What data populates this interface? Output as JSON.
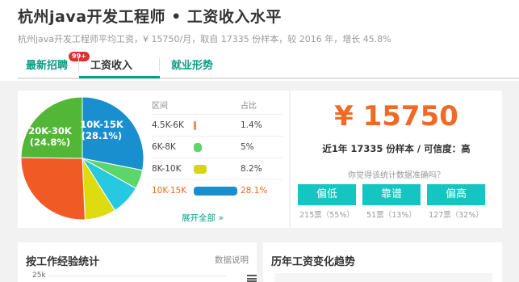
{
  "page": {
    "title": "杭州java开发工程师 • 工资收入水平",
    "subtitle": "杭州java开发工程师平均工资，¥ 15750/月，取自 17335 份样本，较 2016 年，增长 45.8%"
  },
  "tabs": [
    {
      "label": "最新招聘",
      "badge": "99+"
    },
    {
      "label": "工资收入",
      "active": true
    },
    {
      "label": "就业形势"
    }
  ],
  "distribution": {
    "col_range": "区间",
    "col_ratio": "占比",
    "rows": [
      {
        "range": "4.5K-6K",
        "percent": "1.4%",
        "value": 1.4,
        "color": "#ef8a5a"
      },
      {
        "range": "6K-8K",
        "percent": "5%",
        "value": 5,
        "color": "#5ad66a"
      },
      {
        "range": "8K-10K",
        "percent": "8.2%",
        "value": 8.2,
        "color": "#d9d40f"
      },
      {
        "range": "10K-15K",
        "percent": "28.1%",
        "value": 28.1,
        "color": "#1a8fcf",
        "highlight": true
      }
    ],
    "expand_label": "展开全部 »",
    "pie_labels": {
      "blue": "10K-15K\n(28.1%)",
      "blue_line1": "10K-15K",
      "blue_line2": "(28.1%)",
      "green_line1": "20K-30K",
      "green_line2": "(24.8%)"
    },
    "pie_colors": {
      "blue": "#1a8fcf",
      "green": "#52b636",
      "orange": "#ef5a25",
      "yellow": "#dedc0f",
      "cyan": "#28c8e0",
      "lightgreen": "#5ad66a"
    }
  },
  "summary": {
    "salary": "¥ 15750",
    "sample_text": "近1年 17335 份样本 / 可信度：高",
    "question": "你觉得该统计数据准确吗？",
    "votes": [
      {
        "label": "偏低",
        "count": "215票（55%）"
      },
      {
        "label": "靠谱",
        "count": "51票（13%）"
      },
      {
        "label": "偏高",
        "count": "127票（32%）"
      }
    ]
  },
  "experience": {
    "heading": "按工作经验统计",
    "link": "数据说明",
    "axis_top": "25k"
  },
  "trend": {
    "heading": "历年工资变化趋势"
  },
  "colors": {
    "accent": "#0a9c84",
    "orange": "#ef6b25",
    "teal_button": "#14c5c2"
  }
}
